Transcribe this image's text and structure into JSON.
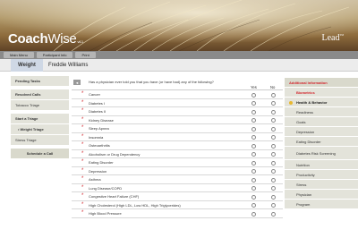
{
  "app": {
    "brand_bold": "Coach",
    "brand_rest": "Wise",
    "version": "v4.1",
    "partner_logo": "Lead",
    "partner_logo_mark": "TM"
  },
  "menu": [
    "Main Menu",
    "Participant Info",
    "Print"
  ],
  "header": {
    "tab_label": "Weight",
    "patient_name": "Freddie Williams"
  },
  "left_nav": [
    {
      "label": "Pending Tasks"
    },
    {
      "label": "Resolved Calls"
    },
    {
      "label": "Tobacco Triage"
    },
    {
      "label": "Start a Triage"
    },
    {
      "label": "• Weight Triage"
    },
    {
      "label": "Stress Triage"
    },
    {
      "label": "Schedule a Call"
    }
  ],
  "questionnaire": {
    "back_label": "◄",
    "question": "Has a physician ever told you that you have (or have had) any of the following?",
    "yes_label": "Yes",
    "no_label": "No",
    "required_mark": "*",
    "conditions": [
      "Cancer",
      "Diabetes I",
      "Diabetes II",
      "Kidney Disease",
      "Sleep Apnea",
      "Insomnia",
      "Osteoarthritis",
      "Alcoholism or Drug Dependency",
      "Eating Disorder",
      "Depression",
      "Asthma",
      "Lung Disease/COPD",
      "Congestive Heart Failure (CHF)",
      "High Cholesterol (High LDL, Low HDL, High Triglycerides)",
      "High Blood Pressure"
    ]
  },
  "right_nav": [
    "Additional Information",
    "Biometrics",
    "Health & Behavior",
    "Readiness",
    "Goals",
    "Depression",
    "Eating Disorder",
    "Diabetes Risk Screening",
    "Nutrition",
    "Productivity",
    "Stress",
    "Physician",
    "Program"
  ]
}
